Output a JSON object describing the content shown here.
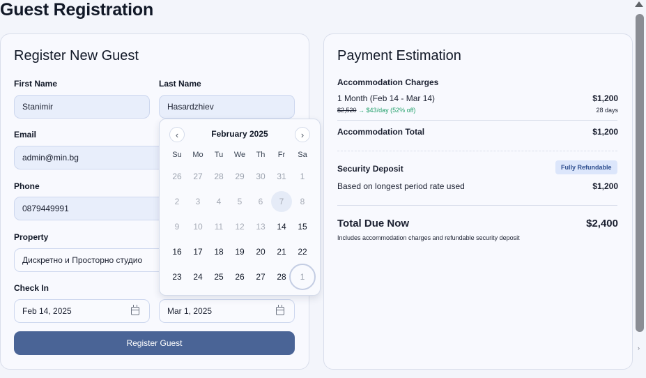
{
  "page": {
    "title": "Guest Registration"
  },
  "form": {
    "title": "Register New Guest",
    "first_name": {
      "label": "First Name",
      "value": "Stanimir"
    },
    "last_name": {
      "label": "Last Name",
      "value": "Hasardzhiev"
    },
    "email": {
      "label": "Email",
      "value": "admin@min.bg"
    },
    "phone": {
      "label": "Phone",
      "value": "0879449991"
    },
    "property": {
      "label": "Property",
      "value": "Дискретно и Просторно студио"
    },
    "check_in": {
      "label": "Check In",
      "value": "Feb 14, 2025"
    },
    "check_out": {
      "value": "Mar 1, 2025"
    },
    "submit_label": "Register Guest"
  },
  "calendar": {
    "month_label": "February 2025",
    "prev_icon": "chevron-left-icon",
    "next_icon": "chevron-right-icon",
    "weekdays": [
      "Su",
      "Mo",
      "Tu",
      "We",
      "Th",
      "Fr",
      "Sa"
    ],
    "weeks": [
      [
        "26",
        "27",
        "28",
        "29",
        "30",
        "31",
        "1"
      ],
      [
        "2",
        "3",
        "4",
        "5",
        "6",
        "7",
        "8"
      ],
      [
        "9",
        "10",
        "11",
        "12",
        "13",
        "14",
        "15"
      ],
      [
        "16",
        "17",
        "18",
        "19",
        "20",
        "21",
        "22"
      ],
      [
        "23",
        "24",
        "25",
        "26",
        "27",
        "28",
        "1"
      ]
    ]
  },
  "payment": {
    "title": "Payment Estimation",
    "accommodation_heading": "Accommodation Charges",
    "period_label": "1 Month (Feb 14 - Mar 14)",
    "period_amount": "$1,200",
    "old_rate": "$2,520",
    "rate_detail": "→ $43/day (52% off)",
    "days": "28 days",
    "accommodation_total_label": "Accommodation Total",
    "accommodation_total": "$1,200",
    "deposit_label": "Security Deposit",
    "deposit_badge": "Fully Refundable",
    "deposit_note": "Based on longest period rate used",
    "deposit_amount": "$1,200",
    "total_label": "Total Due Now",
    "total_amount": "$2,400",
    "total_note": "Includes accommodation charges and refundable security deposit"
  },
  "colors": {
    "accent": "#4a6496",
    "discount_green": "#22a06b",
    "badge_bg": "#dce6fb"
  }
}
